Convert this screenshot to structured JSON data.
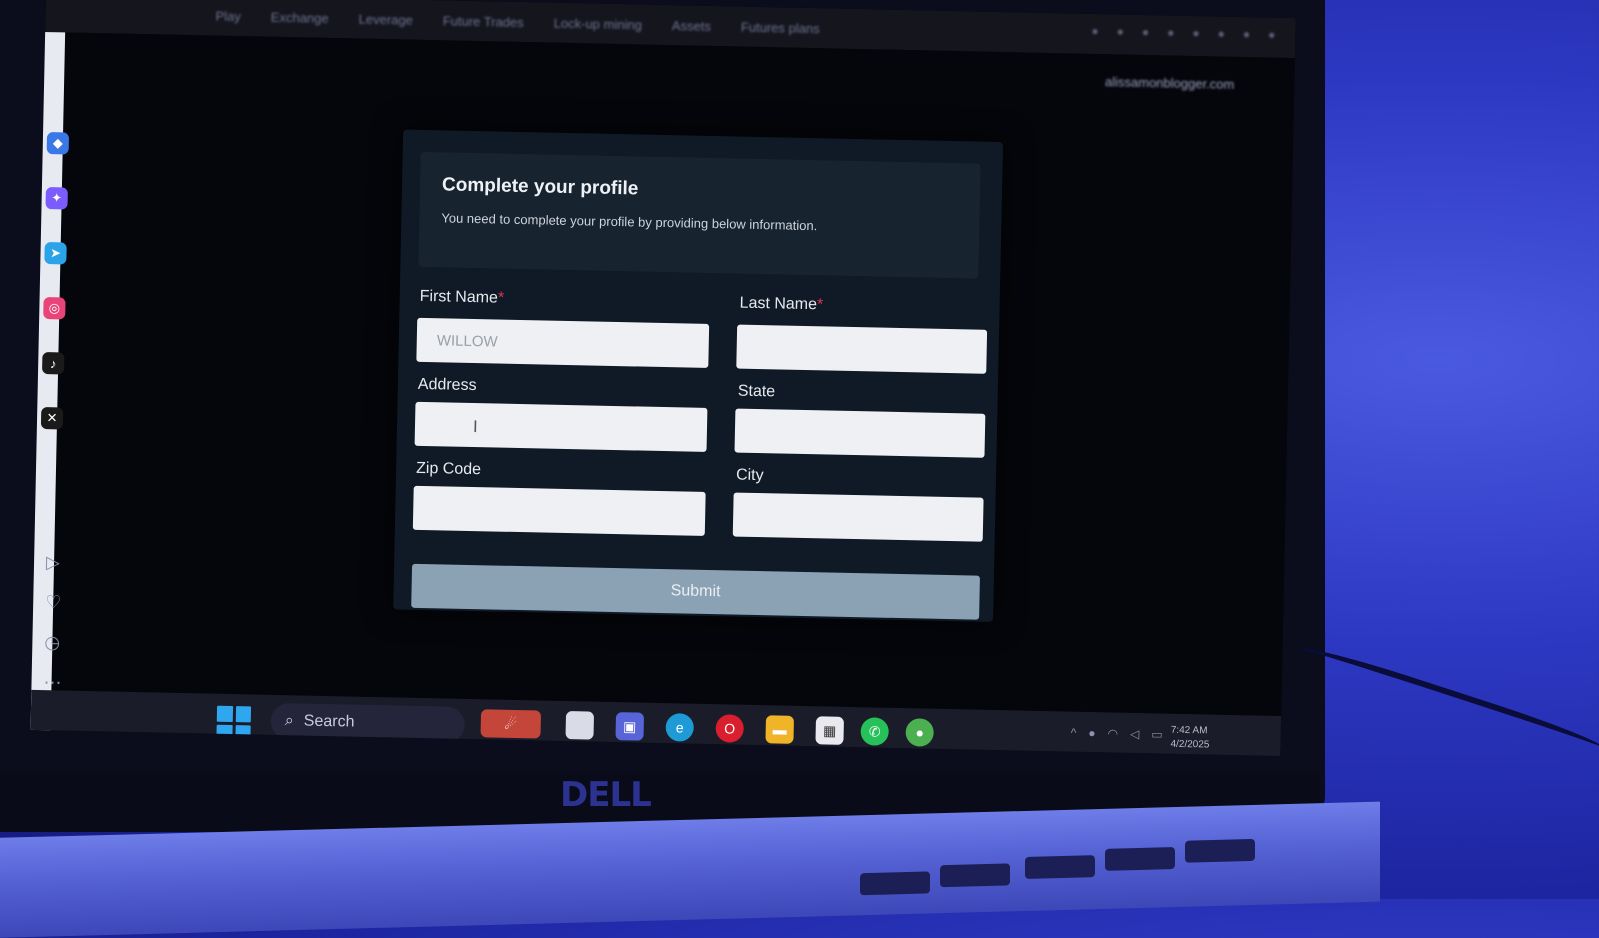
{
  "browser": {
    "tabs": [
      "Play",
      "Exchange",
      "Leverage",
      "Future Trades",
      "Lock-up mining",
      "Assets",
      "Futures plans"
    ],
    "account_email": "alissamonblogger.com"
  },
  "profile_form": {
    "title": "Complete your profile",
    "subtitle": "You need to complete your profile by providing below information.",
    "first_name_label": "First Name",
    "first_name_value": "WILLOW",
    "last_name_label": "Last Name",
    "last_name_value": "",
    "address_label": "Address",
    "address_value": "",
    "state_label": "State",
    "state_value": "",
    "zip_label": "Zip Code",
    "zip_value": "",
    "city_label": "City",
    "city_value": "",
    "required_marker": "*",
    "submit_label": "Submit"
  },
  "taskbar": {
    "search_label": "Search",
    "clock_time": "7:42 AM",
    "clock_date": "4/2/2025"
  },
  "device": {
    "brand": "DELL"
  },
  "colors": {
    "card_bg": "#0f1a26",
    "submit_bg": "#8aa2b4",
    "required": "#e0384a",
    "room_light": "#2e39c4"
  }
}
